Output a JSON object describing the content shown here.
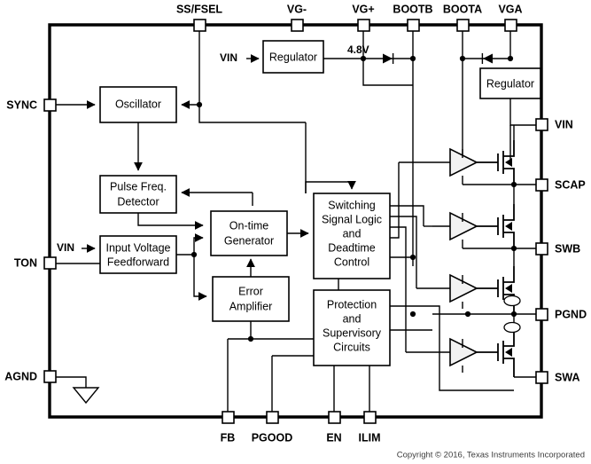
{
  "figure": {
    "type": "functional-block-diagram",
    "copyright": "Copyright © 2016, Texas Instruments Incorporated"
  },
  "blocks": [
    {
      "id": "oscillator",
      "lines": [
        "Oscillator"
      ]
    },
    {
      "id": "regulator_vg",
      "lines": [
        "Regulator"
      ]
    },
    {
      "id": "regulator_vga",
      "lines": [
        "Regulator"
      ]
    },
    {
      "id": "pulse_freq_detector",
      "lines": [
        "Pulse Freq.",
        "Detector"
      ]
    },
    {
      "id": "input_voltage_feedforward",
      "lines": [
        "Input Voltage",
        "Feedforward"
      ]
    },
    {
      "id": "on_time_generator",
      "lines": [
        "On-time",
        "Generator"
      ]
    },
    {
      "id": "error_amplifier",
      "lines": [
        "Error",
        "Amplifier"
      ]
    },
    {
      "id": "switching_logic",
      "lines": [
        "Switching",
        "Signal Logic",
        "and",
        "Deadtime",
        "Control"
      ]
    },
    {
      "id": "protection",
      "lines": [
        "Protection",
        "and",
        "Supervisory",
        "Circuits"
      ]
    }
  ],
  "block_text": {
    "oscillator_l1": "Oscillator",
    "regulator_vg_l1": "Regulator",
    "regulator_vga_l1": "Regulator",
    "pfd_l1": "Pulse Freq.",
    "pfd_l2": "Detector",
    "ivf_l1": "Input Voltage",
    "ivf_l2": "Feedforward",
    "otg_l1": "On-time",
    "otg_l2": "Generator",
    "ea_l1": "Error",
    "ea_l2": "Amplifier",
    "ssl_l1": "Switching",
    "ssl_l2": "Signal Logic",
    "ssl_l3": "and",
    "ssl_l4": "Deadtime",
    "ssl_l5": "Control",
    "prot_l1": "Protection",
    "prot_l2": "and",
    "prot_l3": "Supervisory",
    "prot_l4": "Circuits"
  },
  "pins": {
    "top": [
      {
        "id": "ss_fsel",
        "label": "SS/FSEL"
      },
      {
        "id": "vg_minus",
        "label": "VG-"
      },
      {
        "id": "vg_plus",
        "label": "VG+"
      },
      {
        "id": "bootb",
        "label": "BOOTB"
      },
      {
        "id": "boota",
        "label": "BOOTA"
      },
      {
        "id": "vga",
        "label": "VGA"
      }
    ],
    "left": [
      {
        "id": "sync",
        "label": "SYNC"
      },
      {
        "id": "ton",
        "label": "TON"
      },
      {
        "id": "agnd",
        "label": "AGND"
      }
    ],
    "right": [
      {
        "id": "vin_pin",
        "label": "VIN"
      },
      {
        "id": "scap",
        "label": "SCAP"
      },
      {
        "id": "swb",
        "label": "SWB"
      },
      {
        "id": "pgnd",
        "label": "PGND"
      },
      {
        "id": "swa",
        "label": "SWA"
      }
    ],
    "bottom": [
      {
        "id": "fb",
        "label": "FB"
      },
      {
        "id": "pgood",
        "label": "PGOOD"
      },
      {
        "id": "en",
        "label": "EN"
      },
      {
        "id": "ilim",
        "label": "ILIM"
      }
    ]
  },
  "pin_labels": {
    "ss_fsel": "SS/FSEL",
    "vg_minus": "VG-",
    "vg_plus": "VG+",
    "bootb": "BOOTB",
    "boota": "BOOTA",
    "vga": "VGA",
    "sync": "SYNC",
    "ton": "TON",
    "agnd": "AGND",
    "vin_right": "VIN",
    "scap": "SCAP",
    "swb": "SWB",
    "pgnd": "PGND",
    "swa": "SWA",
    "fb": "FB",
    "pgood": "PGOOD",
    "en": "EN",
    "ilim": "ILIM"
  },
  "net_labels": {
    "vin_regulator": "VIN",
    "vin_feedforward": "VIN",
    "rail_4v8": "4.8V"
  },
  "colors": {
    "line": "#000000",
    "fill": "#ffffff",
    "driver_fill": "#f2f2f2",
    "copyright_text": "#3c3c3c"
  }
}
